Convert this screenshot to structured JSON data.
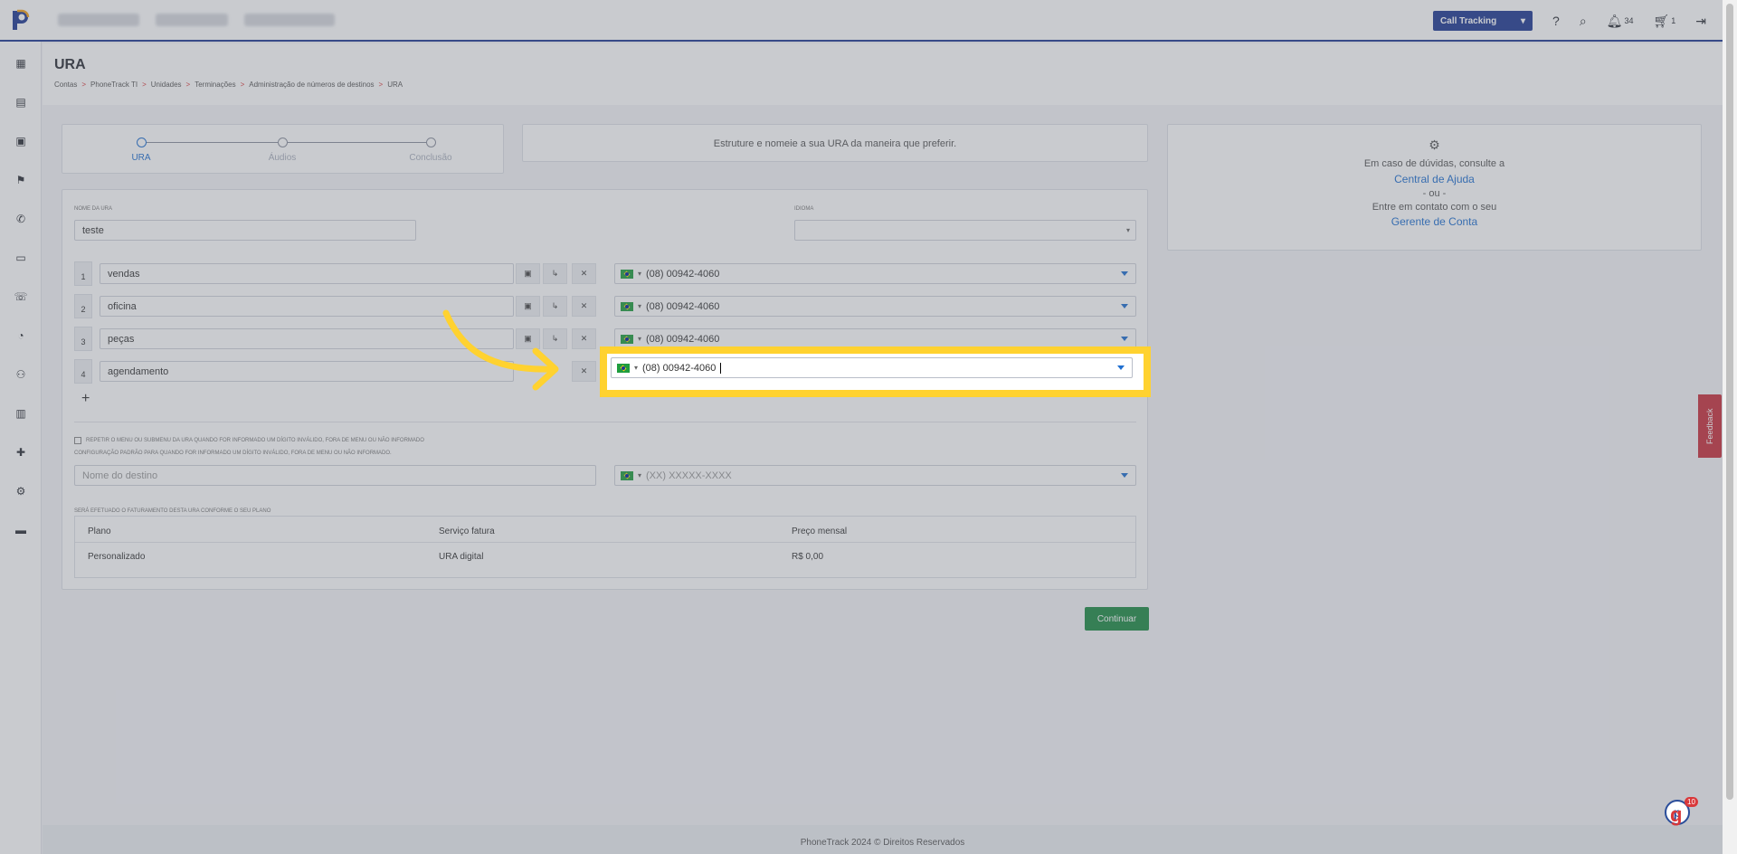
{
  "header": {
    "product_select": "Call Tracking",
    "notifications_count": "34",
    "cart_count": "1"
  },
  "page": {
    "title": "URA",
    "breadcrumb": [
      "Contas",
      "PhoneTrack TI",
      "Unidades",
      "Terminações",
      "Administração de números de destinos",
      "URA"
    ]
  },
  "stepper": {
    "steps": [
      "URA",
      "Áudios",
      "Conclusão"
    ]
  },
  "intro": "Estruture e nomeie a sua URA da maneira que preferir.",
  "help": {
    "line1": "Em caso de dúvidas, consulte a",
    "link1": "Central de Ajuda",
    "or": "- ou -",
    "line2": "Entre em contato com o seu",
    "link2": "Gerente de Conta"
  },
  "form": {
    "name_label": "Nome da URA",
    "name_value": "teste",
    "language_label": "Idioma",
    "language_value": "",
    "options": [
      {
        "number": "1",
        "name": "vendas",
        "phone": "(08) 00942-4060"
      },
      {
        "number": "2",
        "name": "oficina",
        "phone": "(08) 00942-4060"
      },
      {
        "number": "3",
        "name": "peças",
        "phone": "(08) 00942-4060"
      },
      {
        "number": "4",
        "name": "agendamento",
        "phone": "(08) 00942-4060"
      }
    ],
    "add_symbol": "+",
    "repeat_label": "Repetir o menu ou submenu da URA quando for informado um dígito inválido, fora de menu ou não informado",
    "default_config_label": "Configuração padrão para quando for informado um dígito inválido, fora de menu ou não informado.",
    "destination_placeholder": "Nome do destino",
    "phone_placeholder": "(XX) XXXXX-XXXX"
  },
  "billing": {
    "label": "Será efetuado o faturamento desta URA conforme o seu plano",
    "headers": [
      "Plano",
      "Serviço fatura",
      "Preço mensal"
    ],
    "row": [
      "Personalizado",
      "URA digital",
      "R$ 0,00"
    ]
  },
  "buttons": {
    "continue": "Continuar"
  },
  "footer": "PhoneTrack 2024 © Direitos Reservados",
  "feedback": "Feedback",
  "chat_count": "10",
  "colors": {
    "brand": "#1f3a93",
    "highlight": "#ffd230",
    "primary_button": "#1e8a44"
  }
}
